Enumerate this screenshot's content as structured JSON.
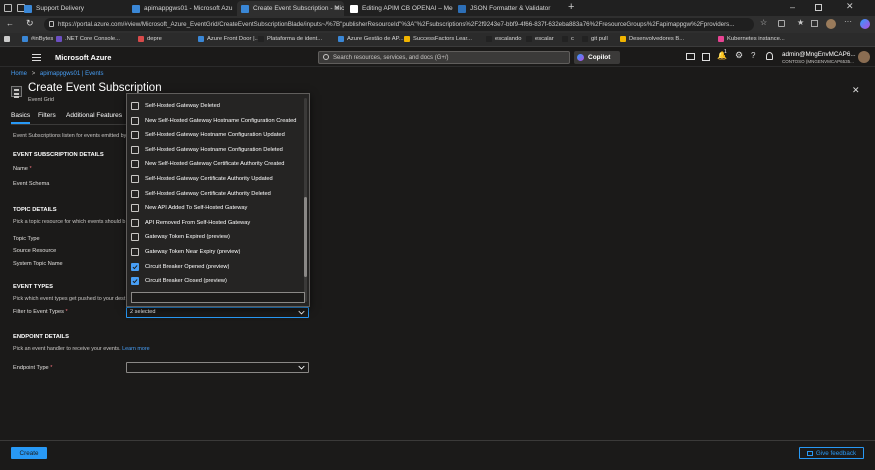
{
  "browser": {
    "tabs": [
      {
        "label": "Support Delivery",
        "active": false,
        "color": "#3a87d6"
      },
      {
        "label": "apimappgws01 - Microsoft Azu",
        "active": false,
        "color": "#3a87d6"
      },
      {
        "label": "Create Event Subscription - Micr",
        "active": true,
        "color": "#3a87d6"
      },
      {
        "label": "Editing APIM CB OPENAI – Mediu",
        "active": false,
        "color": "#ffffff"
      },
      {
        "label": "JSON Formatter & Validator",
        "active": false,
        "color": "#2d6fb7"
      }
    ],
    "url": "https://portal.azure.com/#view/Microsoft_Azure_EventGrid/CreateEventSubscriptionBlade/inputs~/%7B\"publisherResourceId\"%3A\"%2Fsubscriptions%2F2f9243e7-bbf9-4f66-837f-632eba883a76%2FresourceGroups%2Fapimappgw%2Fproviders...",
    "bookmarks": [
      "#inBytes",
      ".NET Core Console...",
      "depre",
      "Azure Front Door |...",
      "Plataforma de ident...",
      "Azure Gestão de AP...",
      "SuccessFactors Lear...",
      "escalando",
      "escalar",
      "c",
      "git pull",
      "Desenvolvedores B...",
      "Kubernetes instance..."
    ]
  },
  "azure": {
    "brand": "Microsoft Azure",
    "search_placeholder": "Search resources, services, and docs (G+/)",
    "copilot": "Copilot",
    "notification_count": "1",
    "user_name": "admin@MngEnvMCAP6...",
    "tenant": "CONTOSO (MNGENVMCAP6535..."
  },
  "page": {
    "breadcrumb_home": "Home",
    "breadcrumb_sep": ">",
    "breadcrumb_resource": "apimappgws01 | Events",
    "title": "Create Event Subscription",
    "subtitle": "Event Grid",
    "tabs": [
      "Basics",
      "Filters",
      "Additional Features"
    ],
    "intro": "Event Subscriptions listen for events emitted by",
    "event_subscription_details": "EVENT SUBSCRIPTION DETAILS",
    "name_label": "Name",
    "event_schema_label": "Event Schema",
    "topic_details": "TOPIC DETAILS",
    "topic_desc": "Pick a topic resource for which events should b",
    "topic_type_label": "Topic Type",
    "source_resource_label": "Source Resource",
    "system_topic_name_label": "System Topic Name",
    "event_types": "EVENT TYPES",
    "event_types_desc": "Pick which event types get pushed to your dest",
    "filter_label": "Filter to Event Types",
    "filter_value": "2 selected",
    "endpoint_details": "ENDPOINT DETAILS",
    "endpoint_desc": "Pick an event handler to receive your events.",
    "learn_more": "Learn more",
    "endpoint_type_label": "Endpoint Type",
    "endpoint_type_value": "",
    "required_mark": "*",
    "create_button": "Create",
    "feedback_button": "Give feedback"
  },
  "dropdown": {
    "options": [
      {
        "label": "Self-Hosted Gateway Deleted",
        "checked": false
      },
      {
        "label": "New Self-Hosted Gateway Hostname Configuration Created",
        "checked": false
      },
      {
        "label": "Self-Hosted Gateway Hostname Configuration Updated",
        "checked": false
      },
      {
        "label": "Self-Hosted Gateway Hostname Configuration Deleted",
        "checked": false
      },
      {
        "label": "New Self-Hosted Gateway Certificate Authority Created",
        "checked": false
      },
      {
        "label": "Self-Hosted Gateway Certificate Authority Updated",
        "checked": false
      },
      {
        "label": "Self-Hosted Gateway Certificate Authority Deleted",
        "checked": false
      },
      {
        "label": "New API Added To Self-Hosted Gateway",
        "checked": false
      },
      {
        "label": "API Removed From Self-Hosted Gateway",
        "checked": false
      },
      {
        "label": "Gateway Token Expired (preview)",
        "checked": false
      },
      {
        "label": "Gateway Token Near Expiry (preview)",
        "checked": false
      },
      {
        "label": "Circuit Breaker Opened (preview)",
        "checked": true
      },
      {
        "label": "Circuit Breaker Closed (preview)",
        "checked": true
      }
    ],
    "filter_value": ""
  },
  "colors": {
    "accent": "#2899f5",
    "checkbox_checked": "#479ef5",
    "link": "#479ef5",
    "background": "#1b1a19"
  }
}
